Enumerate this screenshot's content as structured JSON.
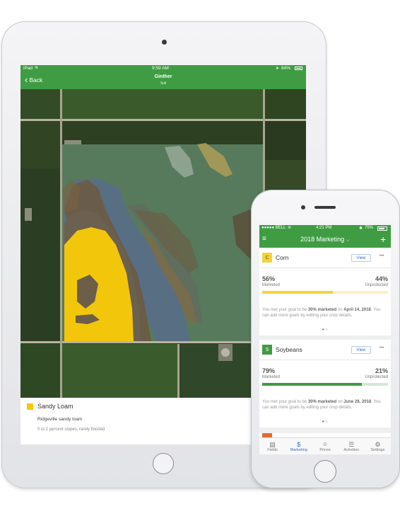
{
  "ipad": {
    "status": {
      "carrier": "iPad",
      "wifi": "wifi-icon",
      "time": "9:59 AM",
      "location": "location-icon",
      "battery_pct": "84%"
    },
    "nav": {
      "back_label": "Back",
      "title": "Ginther",
      "subtitle": "Soil"
    },
    "soil": {
      "name": "Sandy Loam",
      "swatch_color": "#f6c800",
      "type": "Ridgeville sandy loam",
      "description": "0 to 2 percent slopes, rarely flooded"
    }
  },
  "iphone": {
    "status": {
      "carrier": "●●●●● BELL",
      "wifi": "wifi-icon",
      "time": "4:21 PM",
      "bluetooth": "bluetooth-icon",
      "battery_pct": "75%"
    },
    "nav": {
      "menu_icon": "menu-icon",
      "title": "2018 Marketing",
      "dropdown_icon": "chevron-down-icon",
      "add_icon": "plus-icon"
    },
    "crops": [
      {
        "badge": "C",
        "name": "Corn",
        "badge_color": "#f6d23b",
        "bar_color": "#f6d23b",
        "view_label": "View",
        "more_label": "•••",
        "marketed_pct": "56%",
        "marketed_label": "Marketed",
        "marketed_fraction": 0.56,
        "unprotected_pct": "44%",
        "unprotected_label": "Unprotected",
        "goal_pre": "You met your goal to be ",
        "goal_bold": "30% marketed",
        "goal_mid": " on ",
        "goal_date": "April 14, 2018",
        "goal_post": ". You can add more goals by editing your crop details.",
        "dots": "●○"
      },
      {
        "badge": "S",
        "name": "Soybeans",
        "badge_color": "#3f9c43",
        "bar_color": "#3f9c43",
        "view_label": "View",
        "more_label": "•••",
        "marketed_pct": "79%",
        "marketed_label": "Marketed",
        "marketed_fraction": 0.79,
        "unprotected_pct": "21%",
        "unprotected_label": "Unprotected",
        "goal_pre": "You met your goal to be ",
        "goal_bold": "30% marketed",
        "goal_mid": " on ",
        "goal_date": "June 28, 2018",
        "goal_post": ". You can add more goals by editing your crop details.",
        "dots": "●○"
      }
    ],
    "tabs": [
      {
        "label": "Fields",
        "icon": "fields-icon",
        "active": false
      },
      {
        "label": "Marketing",
        "icon": "dollar-icon",
        "active": true
      },
      {
        "label": "Prices",
        "icon": "prices-icon",
        "active": false
      },
      {
        "label": "Activities",
        "icon": "activities-icon",
        "active": false
      },
      {
        "label": "Settings",
        "icon": "gear-icon",
        "active": false
      }
    ]
  },
  "colors": {
    "brand_green": "#3f9c43",
    "active_tab": "#2f6fd1"
  }
}
